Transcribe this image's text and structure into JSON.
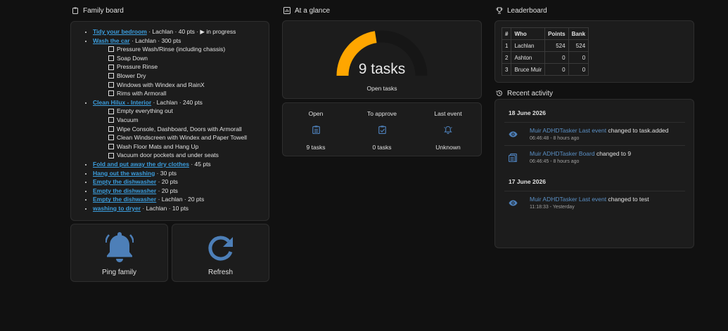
{
  "family_board": {
    "title": "Family board",
    "tasks": [
      {
        "name": "Tidy your bedroom",
        "meta": " · Lachlan · 40 pts · ▶ in progress",
        "subtasks": []
      },
      {
        "name": "Wash the car",
        "meta": " · Lachlan · 300 pts",
        "subtasks": [
          "Pressure Wash/Rinse (including chassis)",
          "Soap Down",
          "Pressure Rinse",
          "Blower Dry",
          "Windows with Windex and RainX",
          "Rims with Armorall"
        ]
      },
      {
        "name": "Clean Hilux - Interior",
        "meta": " · Lachlan · 240 pts",
        "subtasks": [
          "Empty everything out",
          "Vacuum",
          "Wipe Console, Dashboard, Doors with Armorall",
          "Clean Windscreen with Windex and Paper Towell",
          "Wash Floor Mats and Hang Up",
          "Vacuum door pockets and under seats"
        ]
      },
      {
        "name": "Fold and put away the dry clothes",
        "meta": " · 45 pts",
        "subtasks": []
      },
      {
        "name": "Hang out the washing",
        "meta": " · 30 pts",
        "subtasks": []
      },
      {
        "name": "Empty the dishwasher",
        "meta": " · 20 pts",
        "subtasks": []
      },
      {
        "name": "Empty the dishwasher",
        "meta": " · 20 pts",
        "subtasks": []
      },
      {
        "name": "Empty the dishwasher",
        "meta": " · Lachlan · 20 pts",
        "subtasks": []
      },
      {
        "name": "washing to dryer",
        "meta": " · Lachlan · 10 pts",
        "subtasks": []
      }
    ],
    "ping_label": "Ping family",
    "refresh_label": "Refresh"
  },
  "at_a_glance": {
    "title": "At a glance",
    "gauge_value_text": "9 tasks",
    "gauge_fraction": 0.45,
    "gauge_label": "Open tasks",
    "stats": [
      {
        "heading": "Open",
        "value": "9 tasks",
        "icon": "clipboard-list-icon"
      },
      {
        "heading": "To approve",
        "value": "0 tasks",
        "icon": "clipboard-check-icon"
      },
      {
        "heading": "Last event",
        "value": "Unknown",
        "icon": "bell-ring-icon"
      }
    ]
  },
  "leaderboard": {
    "title": "Leaderboard",
    "columns": [
      "#",
      "Who",
      "Points",
      "Bank"
    ],
    "rows": [
      [
        "1",
        "Lachlan",
        "524",
        "524"
      ],
      [
        "2",
        "Ashton",
        "0",
        "0"
      ],
      [
        "3",
        "Bruce Muir",
        "0",
        "0"
      ]
    ]
  },
  "recent_activity": {
    "title": "Recent activity",
    "groups": [
      {
        "date": "18 June 2026",
        "items": [
          {
            "icon": "eye-icon",
            "entity": "Muir ADHDTasker Last event",
            "text": " changed to task.added",
            "time": "06:46:48 - 8 hours ago"
          },
          {
            "icon": "clipboard-list-icon",
            "entity": "Muir ADHDTasker Board",
            "text": " changed to 9",
            "time": "06:46:45 - 8 hours ago"
          }
        ]
      },
      {
        "date": "17 June 2026",
        "items": [
          {
            "icon": "eye-icon",
            "entity": "Muir ADHDTasker Last event",
            "text": " changed to test",
            "time": "11:18:33 - Yesterday"
          }
        ]
      }
    ]
  },
  "colors": {
    "accent": "#ffa600",
    "link": "#3b9ddd",
    "icon": "#4d7fb8",
    "card": "#1c1c1c",
    "background": "#111111"
  }
}
